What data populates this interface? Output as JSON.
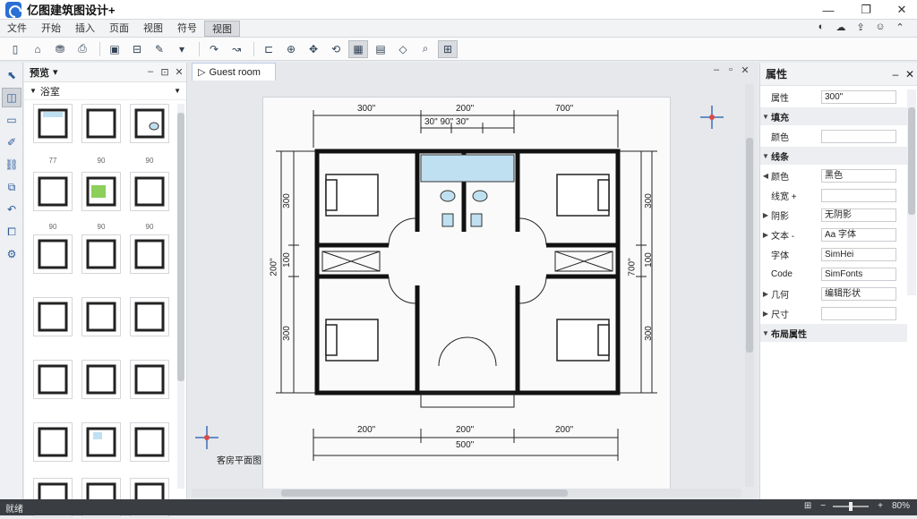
{
  "window": {
    "title": "亿图建筑图设计+"
  },
  "menu": {
    "items": [
      {
        "label": "文件"
      },
      {
        "label": "开始"
      },
      {
        "label": "插入"
      },
      {
        "label": "页面"
      },
      {
        "label": "视图"
      },
      {
        "label": "符号"
      },
      {
        "label": "视图"
      }
    ],
    "active_index": 6
  },
  "library": {
    "title": "预览",
    "subtitle": "浴室",
    "labels": [
      "77",
      "90",
      "90",
      "90",
      "90",
      "90"
    ]
  },
  "canvas": {
    "tab_label": "Guest room",
    "page_label": "客房平面图",
    "dims": {
      "top_left": "300\"",
      "top_middle": "200\"",
      "top_right": "700\"",
      "top_sub": "30\" 90\" 30\"",
      "bottom_left": "200\"",
      "bottom_middle": "200\"",
      "bottom_right": "200\"",
      "bottom_total": "500\"",
      "left_1": "300",
      "left_2": "100",
      "left_3": "300",
      "left_total": "200\"",
      "right_1": "300",
      "right_2": "100",
      "right_3": "300",
      "right_total": "700\""
    }
  },
  "props": {
    "title": "属性",
    "rows": [
      {
        "arrow": "",
        "label": "属性",
        "value": "300\"",
        "group": false
      },
      {
        "arrow": "▼",
        "label": "填充",
        "value": "",
        "group": true
      },
      {
        "arrow": "",
        "label": "颜色",
        "value": "",
        "group": false
      },
      {
        "arrow": "▼",
        "label": "线条",
        "value": "",
        "group": true
      },
      {
        "arrow": "◀",
        "label": "颜色",
        "value": "黑色",
        "group": false
      },
      {
        "arrow": "",
        "label": "线宽 +",
        "value": "",
        "group": false
      },
      {
        "arrow": "▶",
        "label": "阴影",
        "value": "无阴影",
        "group": false
      },
      {
        "arrow": "▶",
        "label": "文本 -",
        "value": "Aa 字体",
        "group": false
      },
      {
        "arrow": "",
        "label": "字体",
        "value": "SimHei",
        "group": false
      },
      {
        "arrow": "",
        "label": "Code",
        "value": "SimFonts",
        "group": false
      },
      {
        "arrow": "▶",
        "label": "几何",
        "value": "编辑形状",
        "group": false
      },
      {
        "arrow": "▶",
        "label": "尺寸",
        "value": "",
        "group": false
      },
      {
        "arrow": "▼",
        "label": "布局属性",
        "value": "",
        "group": true
      }
    ]
  },
  "status": {
    "text": "就绪",
    "zoom": "80%"
  }
}
